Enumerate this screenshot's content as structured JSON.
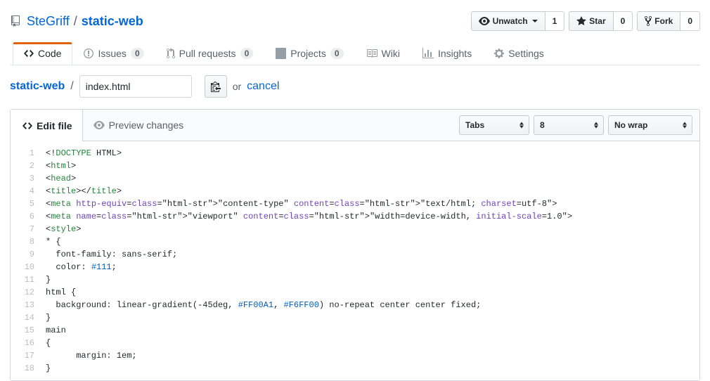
{
  "repo": {
    "owner": "SteGriff",
    "name": "static-web"
  },
  "actions": {
    "unwatch": {
      "label": "Unwatch",
      "count": "1"
    },
    "star": {
      "label": "Star",
      "count": "0"
    },
    "fork": {
      "label": "Fork",
      "count": "0"
    }
  },
  "nav": {
    "code": "Code",
    "issues": {
      "label": "Issues",
      "count": "0"
    },
    "pulls": {
      "label": "Pull requests",
      "count": "0"
    },
    "projects": {
      "label": "Projects",
      "count": "0"
    },
    "wiki": "Wiki",
    "insights": "Insights",
    "settings": "Settings"
  },
  "file": {
    "repo_link": "static-web",
    "name": "index.html",
    "or": "or",
    "cancel": "cancel"
  },
  "editor": {
    "tabs": {
      "edit": "Edit file",
      "preview": "Preview changes"
    },
    "indent_mode": "Tabs",
    "indent_size": "8",
    "wrap": "No wrap"
  },
  "code": [
    "<!DOCTYPE HTML>",
    "<html>",
    "<head>",
    "<title></title>",
    "<meta http-equiv=\"content-type\" content=\"text/html; charset=utf-8\">",
    "<meta name=\"viewport\" content=\"width=device-width, initial-scale=1.0\">",
    "<style>",
    "* {",
    "  font-family: sans-serif;",
    "  color: #111;",
    "}",
    "html {",
    "  background: linear-gradient(-45deg, #FF00A1, #F6FF00) no-repeat center center fixed;",
    "}",
    "main",
    "{",
    "      margin: 1em;",
    "}"
  ]
}
